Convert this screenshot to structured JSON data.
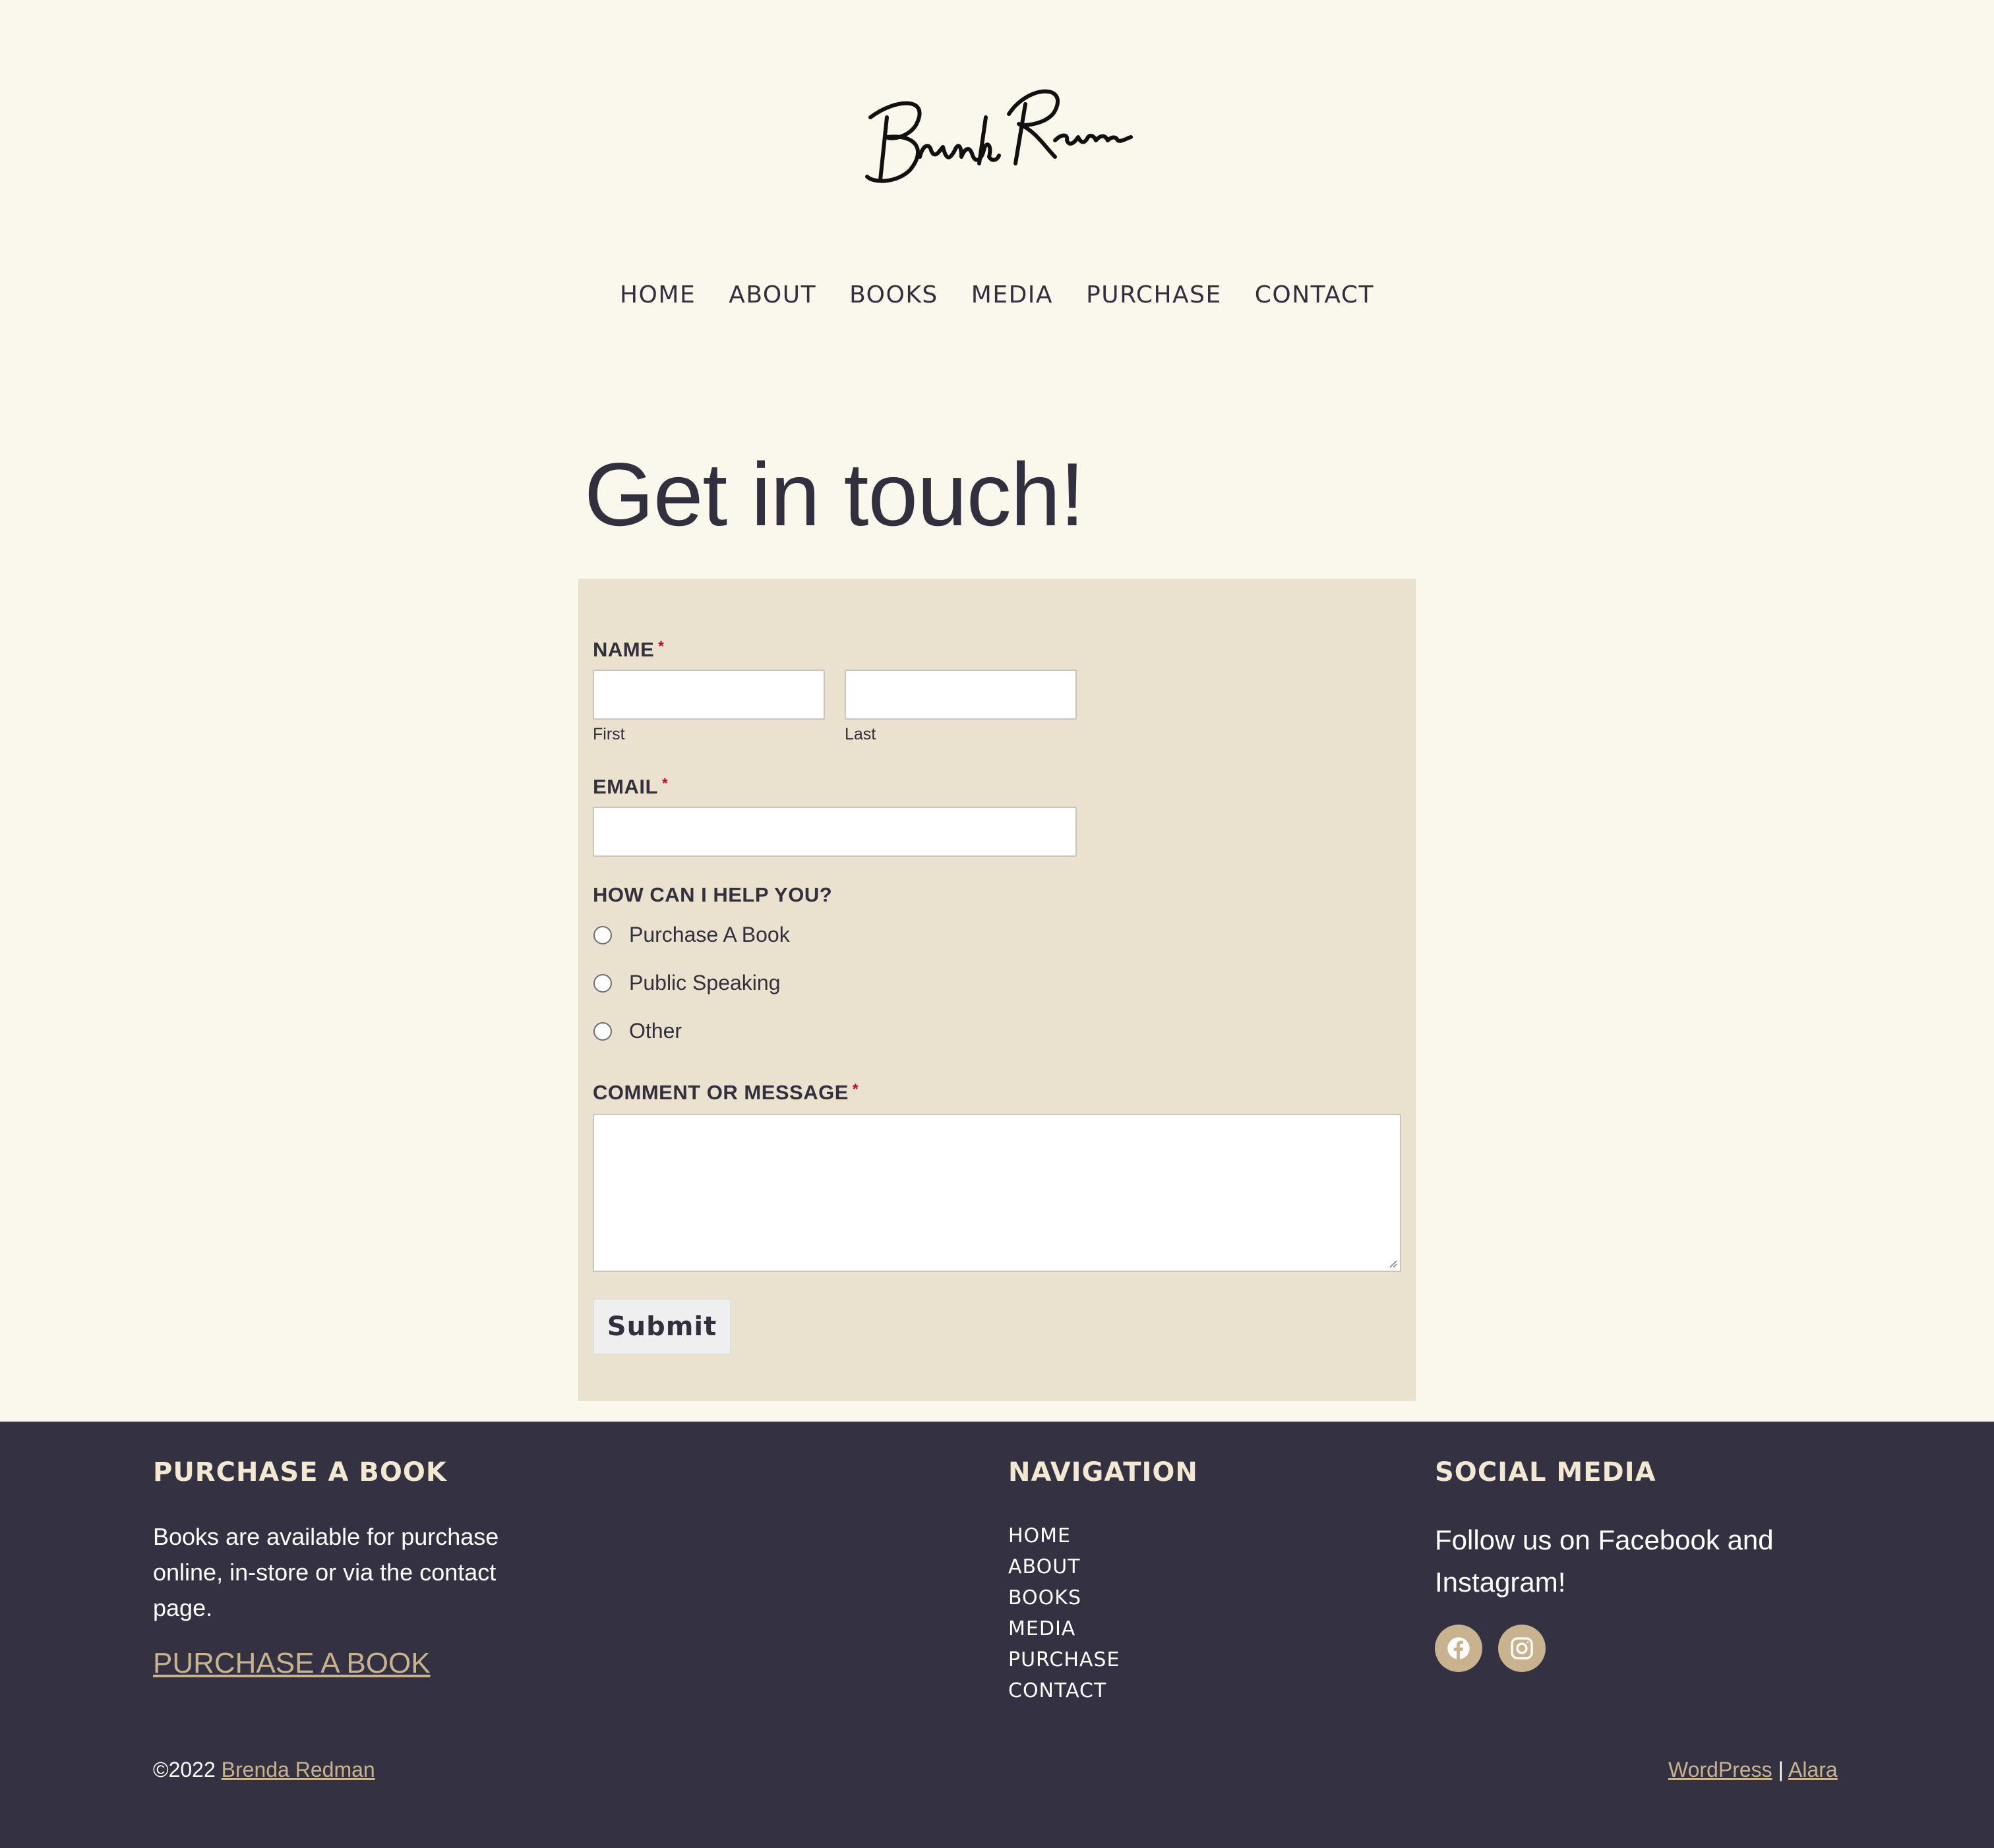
{
  "header": {
    "logo_text": "Brenda Redman"
  },
  "nav": {
    "items": [
      "HOME",
      "ABOUT",
      "BOOKS",
      "MEDIA",
      "PURCHASE",
      "CONTACT"
    ]
  },
  "main": {
    "title": "Get in touch!"
  },
  "form": {
    "name_label": "NAME",
    "required_mark": "*",
    "first_sublabel": "First",
    "last_sublabel": "Last",
    "email_label": "EMAIL",
    "help_label": "HOW CAN I HELP YOU?",
    "options": [
      "Purchase A Book",
      "Public Speaking",
      "Other"
    ],
    "message_label": "COMMENT OR MESSAGE",
    "submit_label": "Submit"
  },
  "footer": {
    "purchase": {
      "heading": "PURCHASE A BOOK",
      "text": "Books are available for purchase online, in-store or via the contact page.",
      "link": "PURCHASE A BOOK"
    },
    "navigation": {
      "heading": "NAVIGATION",
      "items": [
        "HOME",
        "ABOUT",
        "BOOKS",
        "MEDIA",
        "PURCHASE",
        "CONTACT"
      ]
    },
    "social": {
      "heading": "SOCIAL MEDIA",
      "text": "Follow us on Facebook and Instagram!",
      "icons": [
        "facebook-icon",
        "instagram-icon"
      ]
    },
    "copyright_prefix": "©2022",
    "copyright_name": "Brenda Redman",
    "credits_wp": "WordPress",
    "credits_sep": "|",
    "credits_theme": "Alara"
  },
  "colors": {
    "background": "#faf8ec",
    "form_panel": "#eae2cf",
    "footer_bg": "#333142",
    "accent_gold": "#c9b38f",
    "text_dark": "#32303f",
    "required_red": "#d0021b"
  }
}
